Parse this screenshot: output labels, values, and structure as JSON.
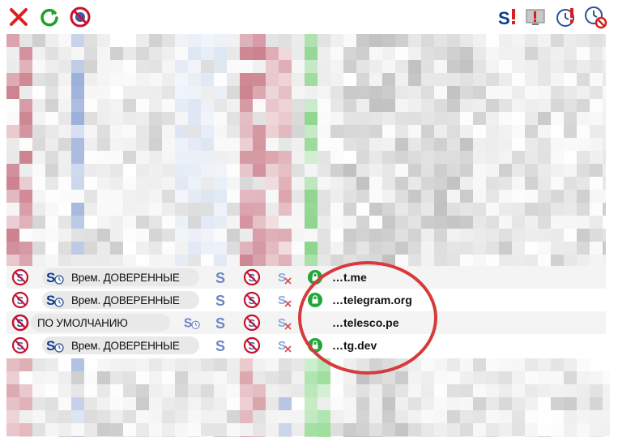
{
  "toolbar": {
    "buttons": [
      {
        "icon": "close-icon",
        "color": "#e02020"
      },
      {
        "icon": "refresh-icon",
        "color": "#1fa02c"
      },
      {
        "icon": "blocked-globe-icon",
        "color": "#c8102e"
      }
    ],
    "right_buttons": [
      {
        "icon": "s-alert-icon",
        "color": "#0b3d91"
      },
      {
        "icon": "screen-alert-icon",
        "color": "#d62020"
      },
      {
        "icon": "clock-alert-icon",
        "color": "#d62020"
      },
      {
        "icon": "clock-blocked-icon",
        "color": "#d62020"
      }
    ]
  },
  "rows": [
    {
      "policy_label": "Врем. ДОВЕРЕННЫЕ",
      "policy_kind": "temp-trusted",
      "domain": "…t.me",
      "secure": true
    },
    {
      "policy_label": "Врем. ДОВЕРЕННЫЕ",
      "policy_kind": "temp-trusted",
      "domain": "…telegram.org",
      "secure": true
    },
    {
      "policy_label": "ПО УМОЛЧАНИЮ",
      "policy_kind": "default",
      "domain": "…telesco.pe",
      "secure": false
    },
    {
      "policy_label": "Врем. ДОВЕРЕННЫЕ",
      "policy_kind": "temp-trusted",
      "domain": "…tg.dev",
      "secure": true
    }
  ],
  "colors": {
    "accent_red": "#d63a3a",
    "secure_green": "#1fa02c",
    "pill_bg": "#e9e9e9",
    "brand_blue": "#0b3d91"
  }
}
